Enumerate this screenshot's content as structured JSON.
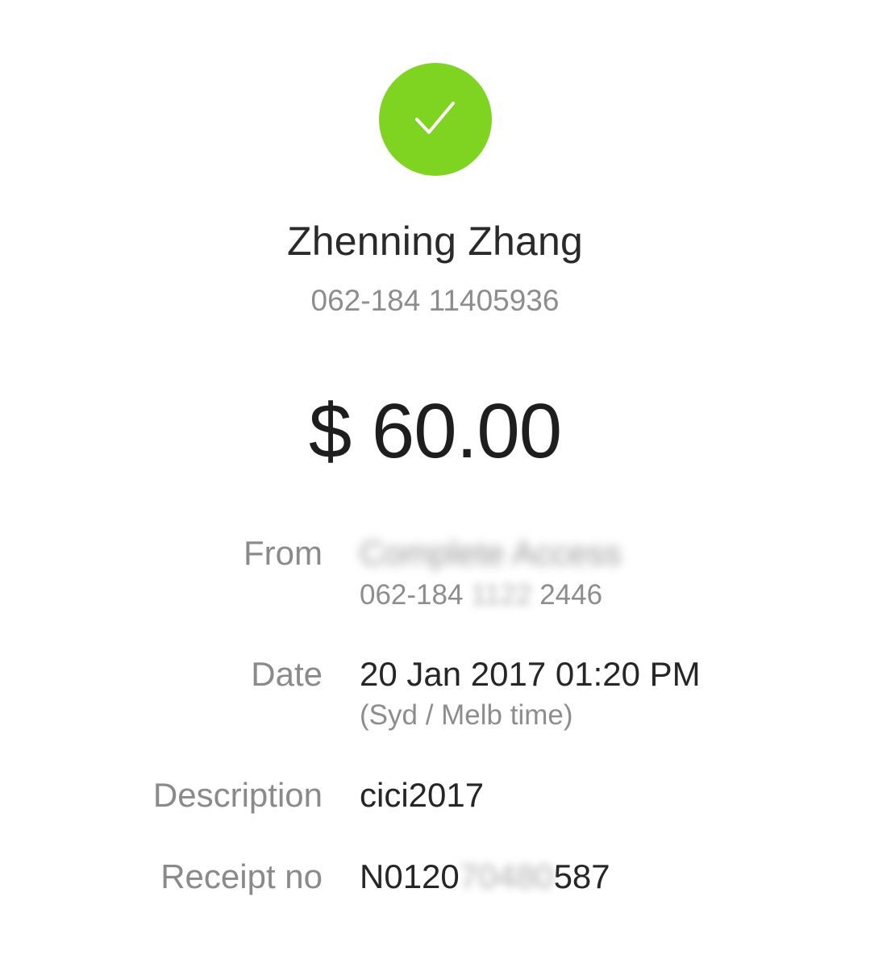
{
  "status": {
    "icon": "checkmark-icon",
    "color": "#7fd321"
  },
  "payee": {
    "name": "Zhenning Zhang",
    "account": "062-184 11405936"
  },
  "amount": "$ 60.00",
  "details": {
    "from": {
      "label": "From",
      "name": "Complete Access",
      "account_prefix": "062-184",
      "account_masked": "1122",
      "account_suffix": "2446"
    },
    "date": {
      "label": "Date",
      "value": "20 Jan 2017 01:20 PM",
      "timezone": "(Syd / Melb time)"
    },
    "description": {
      "label": "Description",
      "value": "cici2017"
    },
    "receipt": {
      "label": "Receipt no",
      "prefix": "N0120",
      "masked": "70480",
      "suffix": "587"
    }
  }
}
